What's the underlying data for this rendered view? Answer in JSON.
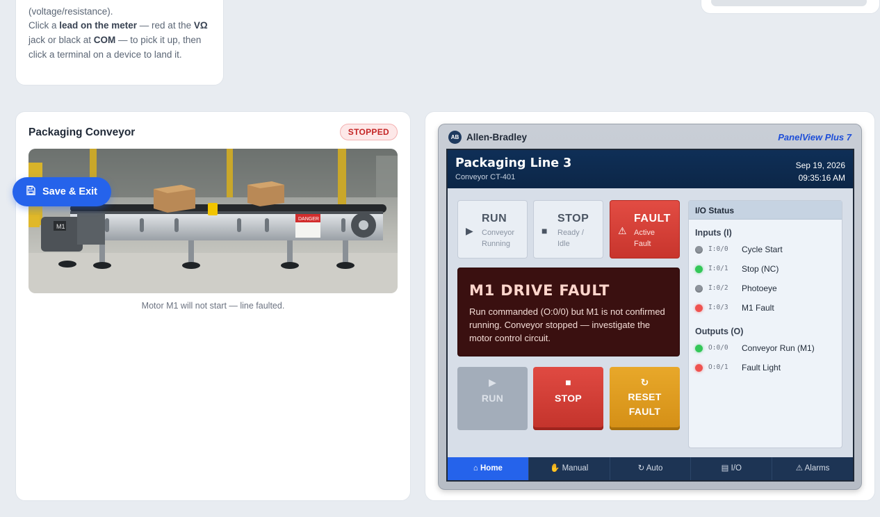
{
  "instructions": {
    "line1": "(voltage/resistance).",
    "p_click_a": "Click a ",
    "p_lead": "lead on the meter",
    "p_red_at": " — red at the ",
    "p_vohm": "VΩ",
    "p_jack": " jack or black at ",
    "p_com": "COM",
    "p_rest": " — to pick it up, then click a terminal on a device to land it."
  },
  "save_exit": {
    "label": "Save & Exit",
    "icon": "save-icon"
  },
  "conveyor_panel": {
    "title": "Packaging Conveyor",
    "status_badge": "STOPPED",
    "caption": "Motor M1 will not start — line faulted.",
    "photo_labels": {
      "motor": "M1",
      "warning": "DANGER"
    }
  },
  "hmi": {
    "brand": "Allen-Bradley",
    "logo": "AB",
    "model": "PanelView Plus 7",
    "header": {
      "title": "Packaging Line 3",
      "subtitle": "Conveyor CT-401",
      "date": "Sep 19, 2026",
      "time": "09:35:16 AM"
    },
    "status_tiles": [
      {
        "title": "RUN",
        "sub": "Conveyor Running",
        "icon": "play-icon",
        "active": false
      },
      {
        "title": "STOP",
        "sub": "Ready / Idle",
        "icon": "stop-square-icon",
        "active": false
      },
      {
        "title": "FAULT",
        "sub": "Active Fault",
        "icon": "warning-triangle-icon",
        "active": true
      }
    ],
    "alarm": {
      "title": "M1 DRIVE FAULT",
      "message": "Run commanded (O:0/0) but M1 is not confirmed running. Conveyor stopped — investigate the motor control circuit."
    },
    "controls": {
      "run": {
        "label": "RUN",
        "icon": "▶",
        "enabled": false
      },
      "stop": {
        "label": "STOP",
        "icon": "■",
        "enabled": true
      },
      "reset": {
        "label": "RESET FAULT",
        "icon": "↻",
        "enabled": true
      }
    },
    "io_status": {
      "title": "I/O Status",
      "inputs_label": "Inputs (I)",
      "outputs_label": "Outputs (O)",
      "inputs": [
        {
          "addr": "I:0/0",
          "name": "Cycle Start",
          "state": "off"
        },
        {
          "addr": "I:0/1",
          "name": "Stop (NC)",
          "state": "green"
        },
        {
          "addr": "I:0/2",
          "name": "Photoeye",
          "state": "off"
        },
        {
          "addr": "I:0/3",
          "name": "M1 Fault",
          "state": "red"
        }
      ],
      "outputs": [
        {
          "addr": "O:0/0",
          "name": "Conveyor Run (M1)",
          "state": "green"
        },
        {
          "addr": "O:0/1",
          "name": "Fault Light",
          "state": "red"
        }
      ]
    },
    "nav": [
      {
        "label": "⌂ Home",
        "active": true
      },
      {
        "label": "✋ Manual",
        "active": false
      },
      {
        "label": "↻ Auto",
        "active": false
      },
      {
        "label": "▤ I/O",
        "active": false
      },
      {
        "label": "⚠ Alarms",
        "active": false
      }
    ]
  },
  "colors": {
    "accent": "#2563eb",
    "fault_red": "#c8352d",
    "alarm_bg": "#3a1010",
    "reset_amber": "#d48f16",
    "hmi_header": "#0f2f57"
  }
}
